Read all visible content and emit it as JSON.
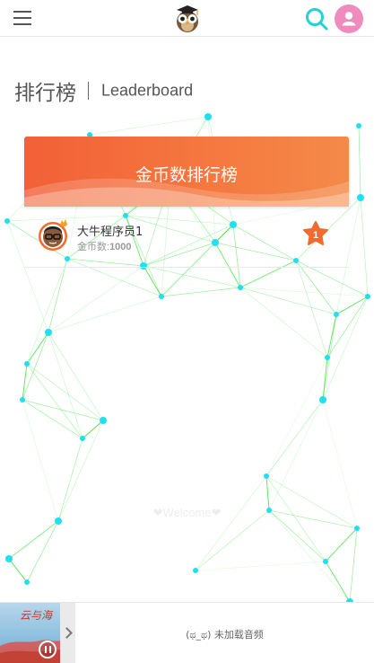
{
  "header": {
    "menu_icon": "hamburger-menu-icon",
    "logo_icon": "owl-graduate-logo-icon",
    "search_icon": "search-icon",
    "user_icon": "user-icon",
    "accent_search": "#1fd3d6",
    "accent_user": "#f08bbd"
  },
  "page": {
    "title_cn": "排行榜",
    "title_en": "Leaderboard"
  },
  "leaderboard": {
    "banner_title": "金币数排行榜",
    "banner_color": "#f26037",
    "entries": [
      {
        "name": "大牛程序员1",
        "coin_label": "金币数:",
        "coin_value": "1000",
        "rank": "1",
        "avatar_icon": "crowned-avatar-icon",
        "badge_icon": "rank-star-icon"
      }
    ]
  },
  "background": {
    "welcome_text": "❤Welcome❤",
    "line_color": "#33dd33",
    "node_color": "#1fe0f0"
  },
  "player": {
    "album_text": "云与海",
    "status_text": "(ಥ_ಥ) 未加载音频",
    "pause_icon": "pause-icon",
    "expand_icon": "chevron-right-icon"
  }
}
